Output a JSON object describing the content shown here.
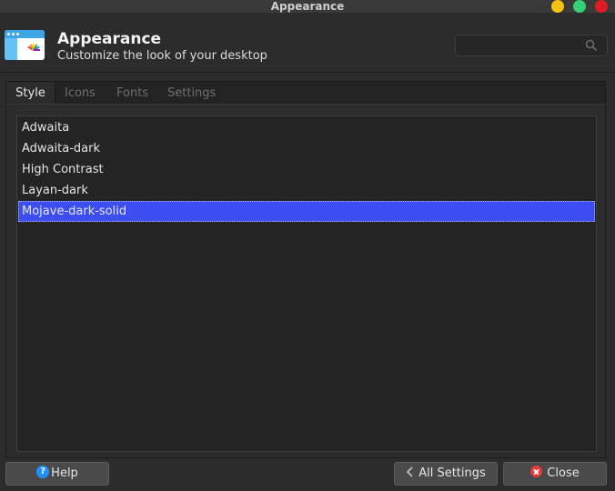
{
  "window": {
    "title": "Appearance"
  },
  "header": {
    "title": "Appearance",
    "subtitle": "Customize the look of your desktop"
  },
  "search": {
    "placeholder": ""
  },
  "tabs": [
    {
      "label": "Style",
      "active": true
    },
    {
      "label": "Icons",
      "active": false
    },
    {
      "label": "Fonts",
      "active": false
    },
    {
      "label": "Settings",
      "active": false
    }
  ],
  "themes": [
    {
      "label": "Adwaita",
      "selected": false
    },
    {
      "label": "Adwaita-dark",
      "selected": false
    },
    {
      "label": "High Contrast",
      "selected": false
    },
    {
      "label": "Layan-dark",
      "selected": false
    },
    {
      "label": "Mojave-dark-solid",
      "selected": true
    }
  ],
  "buttons": {
    "help": "Help",
    "all_settings": "All Settings",
    "close": "Close"
  },
  "colors": {
    "selection": "#3c4ef1",
    "background": "#2c2c2c",
    "list_bg": "#242424"
  },
  "icons": {
    "app": "appearance-app-icon",
    "search": "search-icon",
    "help": "help-icon",
    "back": "chevron-left-icon",
    "close": "close-icon"
  }
}
